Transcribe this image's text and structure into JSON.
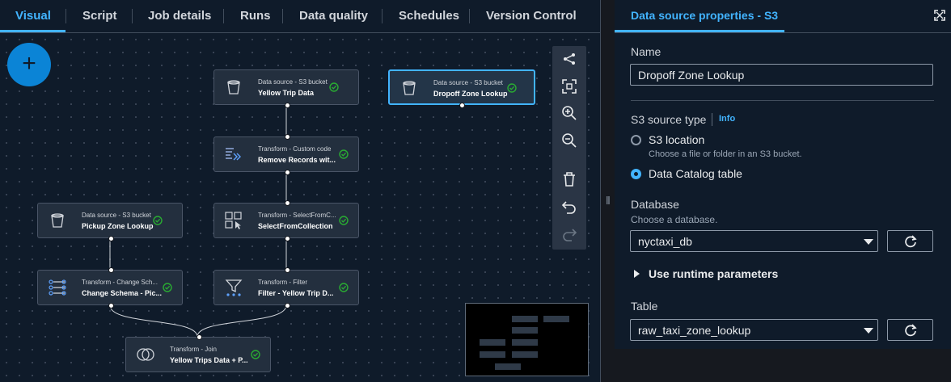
{
  "tabs": [
    {
      "label": "Visual",
      "active": true
    },
    {
      "label": "Script"
    },
    {
      "label": "Job details"
    },
    {
      "label": "Runs"
    },
    {
      "label": "Data quality"
    },
    {
      "label": "Schedules"
    },
    {
      "label": "Version Control"
    }
  ],
  "canvas": {
    "add_button": "+",
    "nodes": [
      {
        "type": "Data source - S3 bucket",
        "title": "Yellow Trip Data",
        "icon": "bucket-icon"
      },
      {
        "type": "Data source - S3 bucket",
        "title": "Dropoff Zone Lookup",
        "icon": "bucket-icon",
        "selected": true
      },
      {
        "type": "Transform - Custom code",
        "title": "Remove Records wit...",
        "icon": "custom-code-icon"
      },
      {
        "type": "Data source - S3 bucket",
        "title": "Pickup Zone Lookup",
        "icon": "bucket-icon"
      },
      {
        "type": "Transform - SelectFromC...",
        "title": "SelectFromCollection",
        "icon": "select-collection-icon"
      },
      {
        "type": "Transform - Change Sch...",
        "title": "Change Schema - Pic...",
        "icon": "change-schema-icon"
      },
      {
        "type": "Transform - Filter",
        "title": "Filter - Yellow Trip D...",
        "icon": "filter-icon"
      },
      {
        "type": "Transform - Join",
        "title": "Yellow Trips Data + P...",
        "icon": "join-icon"
      }
    ],
    "toolbar": [
      "layout-icon",
      "fit-view-icon",
      "zoom-in-icon",
      "zoom-out-icon",
      "delete-icon",
      "undo-icon",
      "redo-icon"
    ],
    "status_color": "#29ad32",
    "accent": "#42b4ff"
  },
  "panel": {
    "title": "Data source properties - S3",
    "name_label": "Name",
    "name_value": "Dropoff Zone Lookup",
    "source_type_label": "S3 source type",
    "info_link": "Info",
    "options": [
      {
        "label": "S3 location",
        "description": "Choose a file or folder in an S3 bucket.",
        "selected": false
      },
      {
        "label": "Data Catalog table",
        "selected": true
      }
    ],
    "database_label": "Database",
    "database_hint": "Choose a database.",
    "database_value": "nyctaxi_db",
    "runtime_label": "Use runtime parameters",
    "table_label": "Table",
    "table_value": "raw_taxi_zone_lookup"
  }
}
